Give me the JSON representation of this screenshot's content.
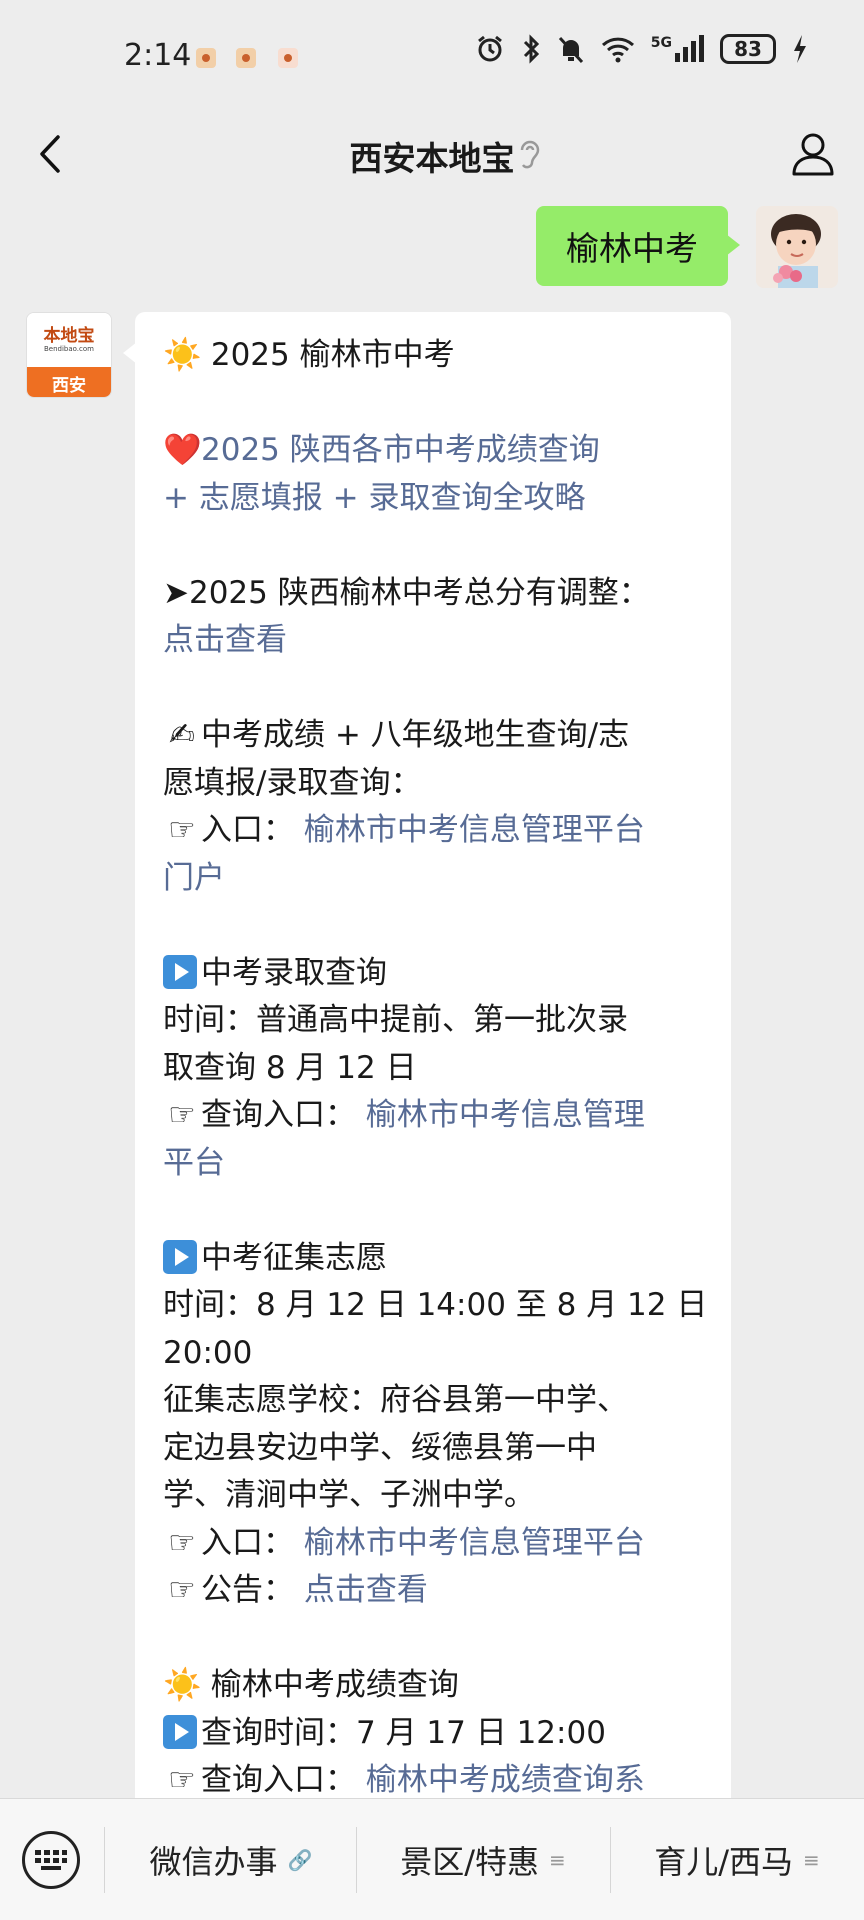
{
  "status_bar": {
    "time": "2:14",
    "battery": "83",
    "network": "5G"
  },
  "nav": {
    "title": "西安本地宝"
  },
  "chat": {
    "user_message": "榆林中考",
    "bot_avatar": {
      "brand": "本地宝",
      "site": "Bendibao.com",
      "city": "西安"
    },
    "lines": {
      "l1": "2025 榆林市中考",
      "l2": "2025 陕西各市中考成绩查询",
      "l3": "+ 志愿填报 + 录取查询全攻略",
      "l4": "➤2025 陕西榆林中考总分有调整：",
      "l5": "点击查看",
      "l6": "中考成绩 + 八年级地生查询/志",
      "l7": "愿填报/录取查询：",
      "l8_prefix": "入口：",
      "l8_link": "榆林市中考信息管理平台",
      "l9": "门户",
      "l10": "中考录取查询",
      "l11": "时间：普通高中提前、第一批次录",
      "l12": "取查询 8 月 12 日",
      "l13_prefix": "查询入口：",
      "l13_link": "榆林市中考信息管理",
      "l14": "平台",
      "l15": "中考征集志愿",
      "l16": "时间：8 月 12 日 14:00 至 8 月 12 日",
      "l17": "20:00",
      "l18": "征集志愿学校：府谷县第一中学、",
      "l19": "定边县安边中学、绥德县第一中",
      "l20": "学、清涧中学、子洲中学。",
      "l21_prefix": "入口：",
      "l21_link": "榆林市中考信息管理平台",
      "l22_prefix": "公告：",
      "l22_link": "点击查看",
      "l23": "榆林中考成绩查询",
      "l24": "查询时间：7 月 17 日 12:00",
      "l25_prefix": "查询入口：",
      "l25_link": "榆林中考成绩查询系"
    },
    "emoji": {
      "sun": "☀️",
      "heart": "❤️",
      "writing": "✍",
      "pointing": "☞"
    }
  },
  "bottom_menu": {
    "items": [
      {
        "label": "微信办事",
        "sub": "🔗"
      },
      {
        "label": "景区/特惠",
        "sub": "≡"
      },
      {
        "label": "育儿/西马",
        "sub": "≡"
      }
    ]
  },
  "colors": {
    "background": "#ededed",
    "user_bubble": "#95ec69",
    "link": "#576b95",
    "brand_orange": "#ee6f22"
  }
}
